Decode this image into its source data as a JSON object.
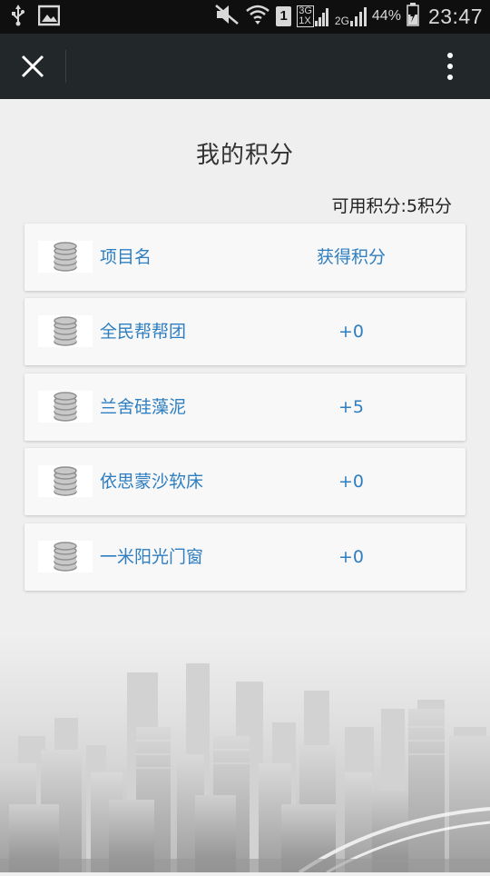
{
  "status_bar": {
    "battery_percent": "44%",
    "time": "23:47",
    "sim_slot": "1",
    "net_top": "3G",
    "net_bottom": "1X",
    "net2": "2G",
    "icons": [
      "usb-icon",
      "image-icon",
      "mute-icon",
      "wifi-icon",
      "signal-icon",
      "battery-icon"
    ]
  },
  "titlebar": {
    "close_icon": "close-icon",
    "more_icon": "more-vertical-icon"
  },
  "page": {
    "title": "我的积分",
    "summary": "可用积分:5积分"
  },
  "table": {
    "header": {
      "name": "项目名",
      "points": "获得积分"
    },
    "rows": [
      {
        "name": "全民帮帮团",
        "points": "+0"
      },
      {
        "name": "兰舍硅藻泥",
        "points": "+5"
      },
      {
        "name": "依思蒙沙软床",
        "points": "+0"
      },
      {
        "name": "一米阳光门窗",
        "points": "+0"
      }
    ]
  },
  "colors": {
    "accent": "#2e7ec0",
    "titlebar": "#22282a",
    "statusbar": "#0f0f0f",
    "background": "#efefef"
  }
}
